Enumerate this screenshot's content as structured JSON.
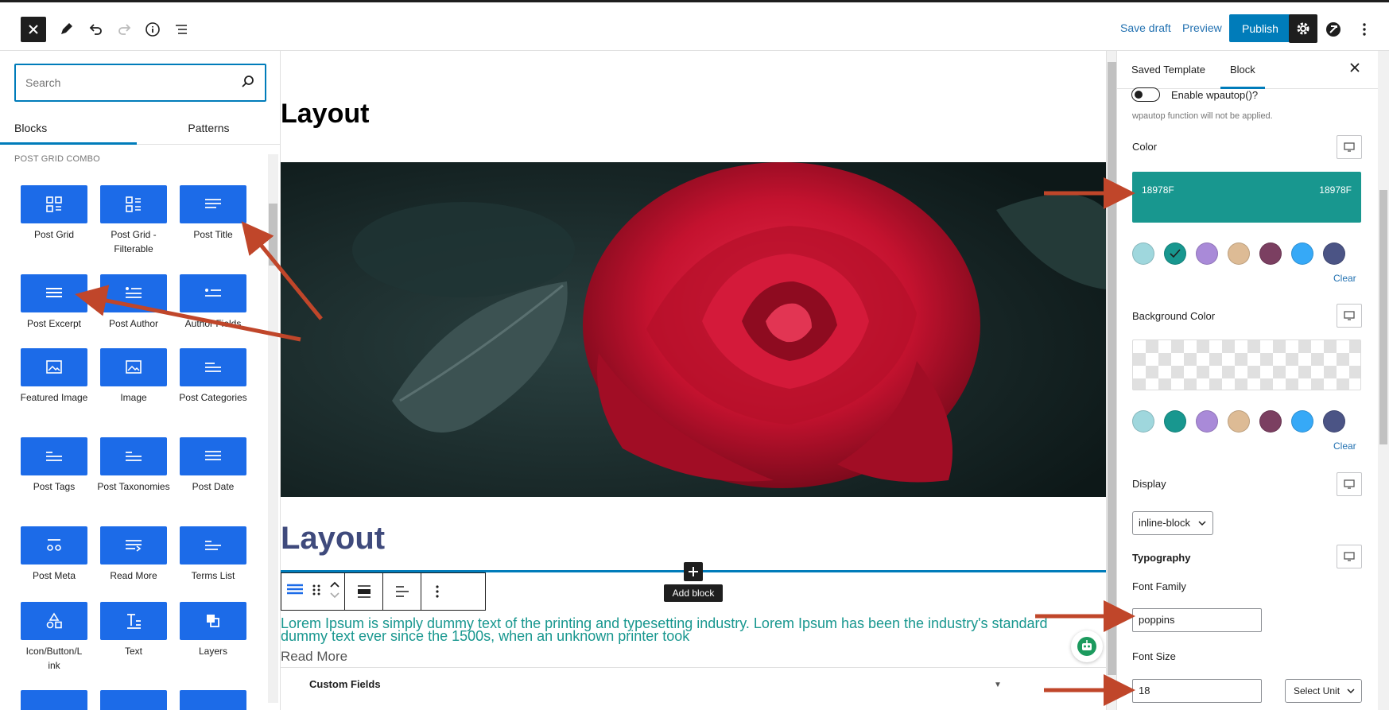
{
  "toolbar": {
    "save_draft": "Save draft",
    "preview": "Preview",
    "publish": "Publish"
  },
  "inserter": {
    "search_placeholder": "Search",
    "tabs": [
      "Blocks",
      "Patterns"
    ],
    "category": "POST GRID COMBO",
    "blocks": [
      {
        "label": "Post Grid",
        "icon": "grid-icon"
      },
      {
        "label": "Post Grid - Filterable",
        "icon": "grid-filter-icon"
      },
      {
        "label": "Post Title",
        "icon": "lines-icon"
      },
      {
        "label": "Post Excerpt",
        "icon": "excerpt-icon"
      },
      {
        "label": "Post Author",
        "icon": "author-icon"
      },
      {
        "label": "Author Fields",
        "icon": "author-fields-icon"
      },
      {
        "label": "Featured Image",
        "icon": "image-icon"
      },
      {
        "label": "Image",
        "icon": "image-icon"
      },
      {
        "label": "Post Categories",
        "icon": "categories-icon"
      },
      {
        "label": "Post Tags",
        "icon": "tags-icon"
      },
      {
        "label": "Post Taxonomies",
        "icon": "taxonomies-icon"
      },
      {
        "label": "Post Date",
        "icon": "date-icon"
      },
      {
        "label": "Post Meta",
        "icon": "meta-icon"
      },
      {
        "label": "Read More",
        "icon": "read-more-icon"
      },
      {
        "label": "Terms List",
        "icon": "terms-icon"
      },
      {
        "label": "Icon/Button/Link",
        "icon": "shapes-icon"
      },
      {
        "label": "Text",
        "icon": "text-icon"
      },
      {
        "label": "Layers",
        "icon": "layers-icon"
      }
    ]
  },
  "canvas": {
    "heading1": "Layout",
    "heading2": "Layout",
    "add_block_tooltip": "Add block",
    "excerpt": "Lorem Ipsum is simply dummy text of the printing and typesetting industry. Lorem Ipsum has been the industry's standard dummy text ever since the 1500s, when an unknown printer took",
    "read_more": "Read More",
    "custom_fields": "Custom Fields"
  },
  "sidebar": {
    "tabs": [
      "Saved Template",
      "Block"
    ],
    "toggle_label": "Enable wpautop()?",
    "toggle_help": "wpautop function will not be applied.",
    "color_label": "Color",
    "color_value_left": "18978F",
    "color_value_right": "18978F",
    "swatches": [
      "#9fd7dd",
      "#18978f",
      "#a98ad8",
      "#ddbb95",
      "#7b3f61",
      "#36a9f7",
      "#4b5485"
    ],
    "clear": "Clear",
    "bg_color_label": "Background Color",
    "display_label": "Display",
    "display_value": "inline-block",
    "typography_label": "Typography",
    "font_family_label": "Font Family",
    "font_family_value": "poppins",
    "font_size_label": "Font Size",
    "font_size_value": "18",
    "unit_value": "Select Unit"
  },
  "colors": {
    "accent": "#007cba",
    "block_icon_bg": "#1c6be8",
    "text_color": "#18978f",
    "annotation_arrow": "#c0462a"
  }
}
